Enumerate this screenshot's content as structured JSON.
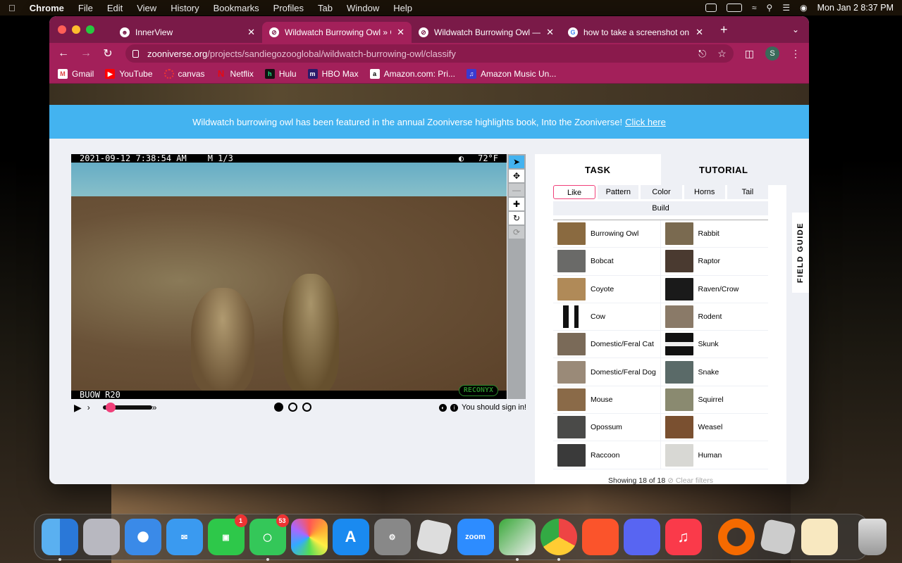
{
  "menubar": {
    "app": "Chrome",
    "items": [
      "File",
      "Edit",
      "View",
      "History",
      "Bookmarks",
      "Profiles",
      "Tab",
      "Window",
      "Help"
    ],
    "clock": "Mon Jan 2  8:37 PM"
  },
  "tabs": [
    {
      "title": "InnerView"
    },
    {
      "title": "Wildwatch Burrowing Owl » Cla"
    },
    {
      "title": "Wildwatch Burrowing Owl — Zo"
    },
    {
      "title": "how to take a screenshot on m"
    }
  ],
  "address": {
    "domain": "zooniverse.org",
    "path": "/projects/sandiegozooglobal/wildwatch-burrowing-owl/classify"
  },
  "profile_initial": "S",
  "bookmarks": [
    "Gmail",
    "YouTube",
    "canvas",
    "Netflix",
    "Hulu",
    "HBO Max",
    "Amazon.com: Pri...",
    "Amazon Music Un..."
  ],
  "banner": {
    "text": "Wildwatch burrowing owl has been featured in the annual Zooniverse highlights book, Into the Zooniverse!",
    "link": "Click here"
  },
  "camera": {
    "datetime": "2021-09-12  7:38:54 AM",
    "frame": "M 1/3",
    "temp": "72°F",
    "cam_id": "BUOW R20",
    "brand": "RECONYX"
  },
  "signin": "You should sign in!",
  "panel": {
    "tab_task": "TASK",
    "tab_tutorial": "TUTORIAL",
    "filters": [
      "Like",
      "Pattern",
      "Color",
      "Horns",
      "Tail"
    ],
    "filter_build": "Build"
  },
  "species": [
    "Burrowing Owl",
    "Rabbit",
    "Bobcat",
    "Raptor",
    "Coyote",
    "Raven/Crow",
    "Cow",
    "Rodent",
    "Domestic/Feral Cat",
    "Skunk",
    "Domestic/Feral Dog",
    "Snake",
    "Mouse",
    "Squirrel",
    "Opossum",
    "Weasel",
    "Raccoon",
    "Human"
  ],
  "showing": "Showing 18 of 18",
  "clear_filters": "Clear filters",
  "field_guide": "FIELD GUIDE",
  "dock": {
    "facetime_badge": "1",
    "messages_badge": "53",
    "zoom_label": "zoom"
  }
}
